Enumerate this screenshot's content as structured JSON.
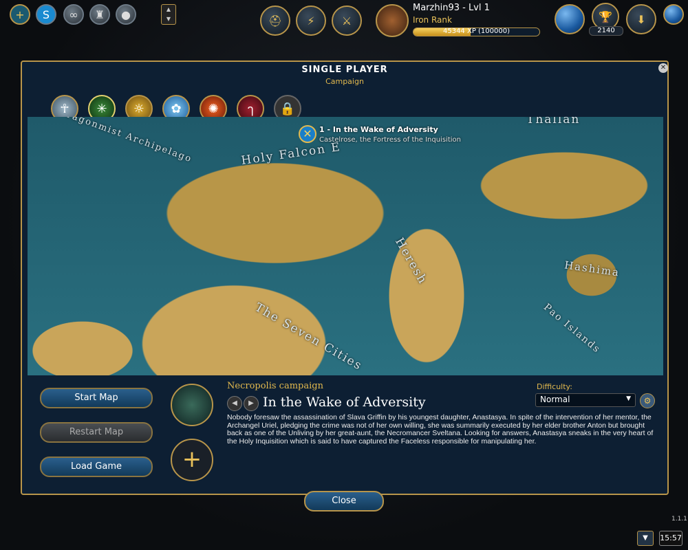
{
  "topbar": {
    "left_icons": [
      "plus-icon",
      "skype-icon",
      "chain-icon",
      "helmet-icon",
      "stones-icon"
    ],
    "center_icons": [
      "faction-helmet-icon",
      "lightning-icon",
      "crossed-axes-icon"
    ],
    "player_name": "Marzhin93 - Lvl 1",
    "rank": "Iron Rank",
    "xp_text": "45344 XP (100000)",
    "xp_progress": 0.453,
    "gold": "2140"
  },
  "panel": {
    "title": "SINGLE PLAYER",
    "subtitle": "Campaign",
    "factions": [
      "haven",
      "sylvan",
      "academy",
      "stronghold",
      "inferno",
      "necropolis",
      "locked"
    ]
  },
  "map": {
    "marker_title": "1 - In the Wake of Adversity",
    "marker_subtitle": "Castelrose, the Fortress of the Inquisition",
    "labels": [
      "Dragonmist Archipelago",
      "Holy Falcon E",
      "Thallan",
      "Heresh",
      "Hashima",
      "Pao Islands",
      "The Seven Cities"
    ]
  },
  "buttons": {
    "start": "Start Map",
    "restart": "Restart Map",
    "load": "Load Game",
    "close": "Close"
  },
  "campaign": {
    "name": "Necropolis campaign",
    "map_title": "In the Wake of Adversity",
    "description": "Nobody foresaw the assassination of Slava Griffin by his youngest daughter, Anastasya. In spite of the intervention of her mentor, the Archangel Uriel, pledging the crime was not of her own willing, she was summarily executed by her elder brother Anton but brought back as one of the Unliving by her great-aunt, the Necromancer Sveltana. Looking for answers, Anastasya sneaks in the very heart of the Holy Inquisition which is said to have captured the Faceless responsible for manipulating her.",
    "difficulty_label": "Difficulty:",
    "difficulty": "Normal"
  },
  "footer": {
    "version": "1.1.1",
    "time": "15:57"
  },
  "colors": {
    "gold": "#b8954a",
    "accent": "#e2b94e",
    "panel": "#0d1f33"
  }
}
